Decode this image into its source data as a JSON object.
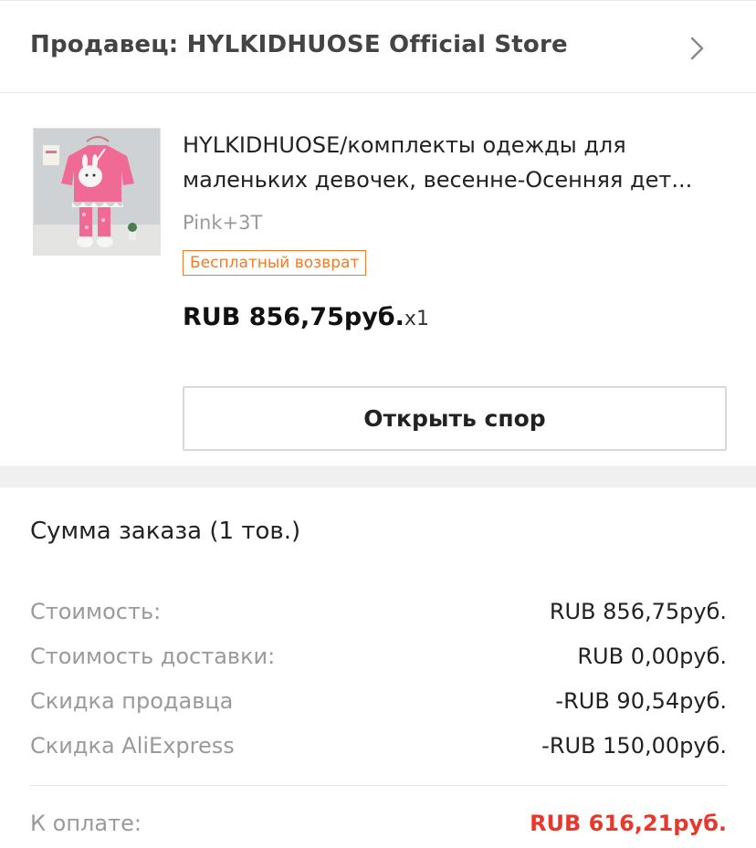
{
  "seller": {
    "label": "Продавец: HYLKIDHUOSE Official Store",
    "chevron_icon": "chevron-right-icon"
  },
  "product": {
    "image_icon": "product-thumbnail",
    "title_line1": "HYLKIDHUOSE/комплекты одежды для",
    "title_line2": "маленьких девочек, весенне-Осенняя дет...",
    "variant": "Pink+3T",
    "badge": "Бесплатный возврат",
    "price": "RUB 856,75руб.",
    "quantity": "x1",
    "dispute_button": "Открыть спор"
  },
  "summary": {
    "title": "Сумма заказа (1 тов.)",
    "lines": [
      {
        "label": "Стоимость:",
        "value": "RUB 856,75руб."
      },
      {
        "label": "Стоимость доставки:",
        "value": "RUB 0,00руб."
      },
      {
        "label": "Скидка продавца",
        "value": "-RUB 90,54руб."
      },
      {
        "label": "Скидка AliExpress",
        "value": "-RUB 150,00руб."
      }
    ],
    "total_label": "К оплате:",
    "total_value": "RUB 616,21руб."
  },
  "colors": {
    "accent_orange": "#f07b2a",
    "total_red": "#e8382c",
    "muted_gray": "#9a9a9a"
  }
}
